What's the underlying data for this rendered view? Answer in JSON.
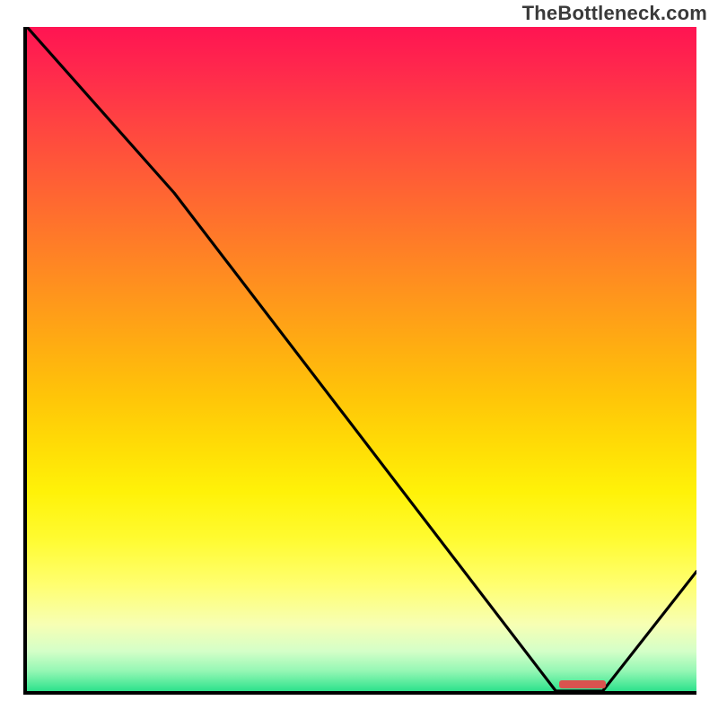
{
  "attribution": "TheBottleneck.com",
  "chart_data": {
    "type": "line",
    "title": "",
    "xlabel": "",
    "ylabel": "",
    "xlim": [
      0,
      100
    ],
    "ylim": [
      0,
      100
    ],
    "series": [
      {
        "name": "bottleneck-curve",
        "x": [
          0,
          22,
          79,
          82,
          86,
          100
        ],
        "y": [
          100,
          75,
          0,
          0,
          0,
          18
        ]
      }
    ],
    "optimal_range_x": [
      79,
      86
    ],
    "gradient_stops": [
      {
        "pos": 0.0,
        "color": "#ff1452"
      },
      {
        "pos": 0.5,
        "color": "#ffb010"
      },
      {
        "pos": 0.8,
        "color": "#fffb30"
      },
      {
        "pos": 1.0,
        "color": "#2de28c"
      }
    ]
  }
}
